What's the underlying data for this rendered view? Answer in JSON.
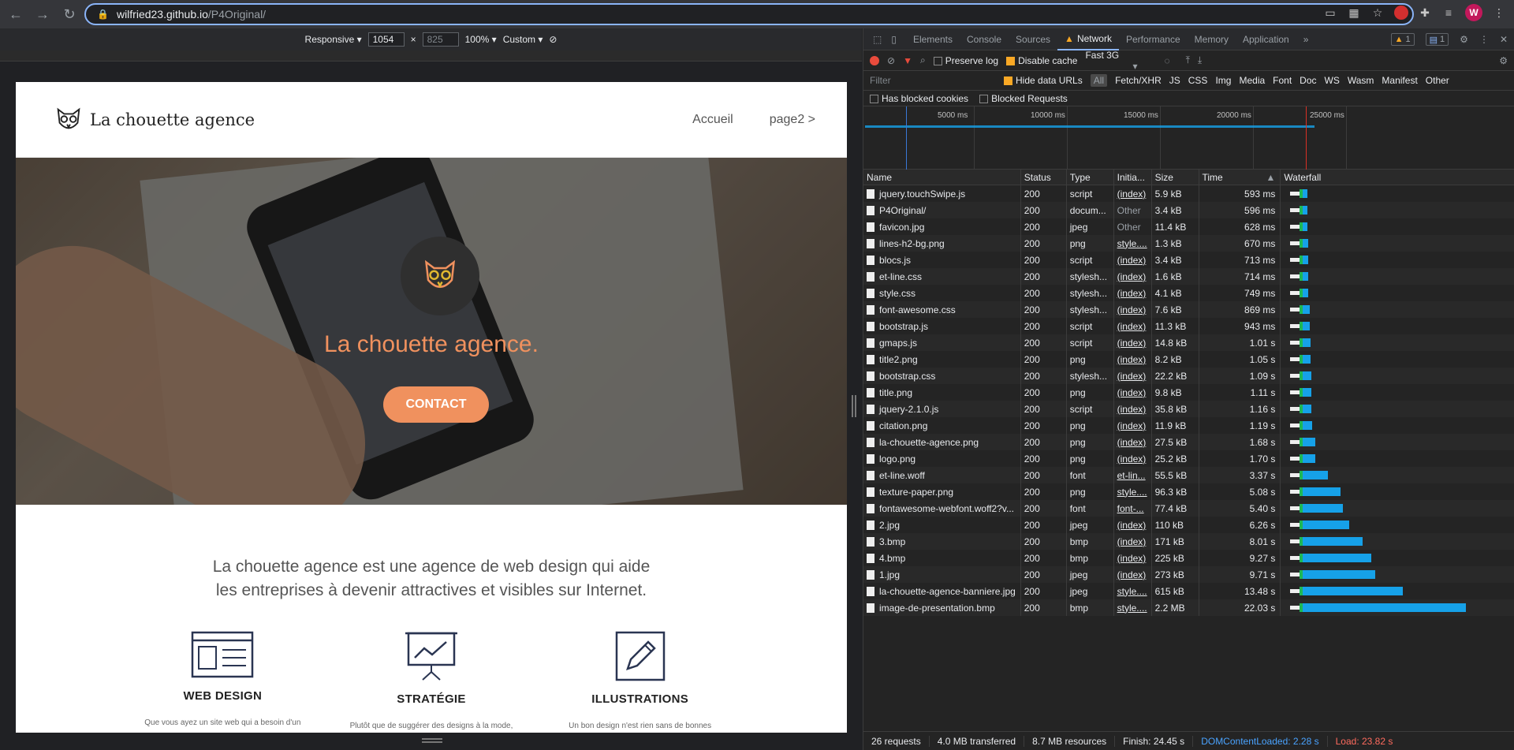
{
  "browser": {
    "url_host": "wilfried23.github.io",
    "url_path": "/P4Original/",
    "avatar_letter": "W"
  },
  "device_toolbar": {
    "mode": "Responsive",
    "width": "1054",
    "height": "825",
    "zoom": "100%",
    "throttle": "Custom"
  },
  "site": {
    "brand": "La chouette agence",
    "nav": [
      "Accueil",
      "page2 >"
    ],
    "hero_title": "La chouette agence.",
    "contact": "CONTACT",
    "intro_line1": "La chouette agence est une agence de web design qui aide",
    "intro_line2": "les entreprises à devenir attractives et visibles sur Internet.",
    "features": [
      {
        "title": "WEB DESIGN",
        "text": "Que vous ayez un site web qui a besoin d'un"
      },
      {
        "title": "STRATÉGIE",
        "text": "Plutôt que de suggérer des designs à la mode,"
      },
      {
        "title": "ILLUSTRATIONS",
        "text": "Un bon design n'est rien sans de bonnes"
      }
    ],
    "accent": "#f0915e"
  },
  "devtools": {
    "tabs": [
      "Elements",
      "Console",
      "Sources",
      "Network",
      "Performance",
      "Memory",
      "Application"
    ],
    "active_tab": "Network",
    "warn_count": "1",
    "msg_count": "1",
    "preserve_log": "Preserve log",
    "disable_cache": "Disable cache",
    "throttle": "Fast 3G",
    "filter_placeholder": "Filter",
    "hide_data_urls": "Hide data URLs",
    "all": "All",
    "types": [
      "Fetch/XHR",
      "JS",
      "CSS",
      "Img",
      "Media",
      "Font",
      "Doc",
      "WS",
      "Wasm",
      "Manifest",
      "Other"
    ],
    "has_blocked_cookies": "Has blocked cookies",
    "blocked_requests": "Blocked Requests",
    "overview_ticks": [
      "5000 ms",
      "10000 ms",
      "15000 ms",
      "20000 ms",
      "25000 ms"
    ],
    "columns": [
      "Name",
      "Status",
      "Type",
      "Initia...",
      "Size",
      "Time",
      "Waterfall"
    ],
    "requests": [
      {
        "name": "jquery.touchSwipe.js",
        "status": "200",
        "type": "script",
        "initiator": "(index)",
        "size": "5.9 kB",
        "time": "593 ms",
        "ms": 593
      },
      {
        "name": "P4Original/",
        "status": "200",
        "type": "docum...",
        "initiator": "Other",
        "size": "3.4 kB",
        "time": "596 ms",
        "ms": 596
      },
      {
        "name": "favicon.jpg",
        "status": "200",
        "type": "jpeg",
        "initiator": "Other",
        "size": "11.4 kB",
        "time": "628 ms",
        "ms": 628
      },
      {
        "name": "lines-h2-bg.png",
        "status": "200",
        "type": "png",
        "initiator": "style....",
        "size": "1.3 kB",
        "time": "670 ms",
        "ms": 670
      },
      {
        "name": "blocs.js",
        "status": "200",
        "type": "script",
        "initiator": "(index)",
        "size": "3.4 kB",
        "time": "713 ms",
        "ms": 713
      },
      {
        "name": "et-line.css",
        "status": "200",
        "type": "stylesh...",
        "initiator": "(index)",
        "size": "1.6 kB",
        "time": "714 ms",
        "ms": 714
      },
      {
        "name": "style.css",
        "status": "200",
        "type": "stylesh...",
        "initiator": "(index)",
        "size": "4.1 kB",
        "time": "749 ms",
        "ms": 749
      },
      {
        "name": "font-awesome.css",
        "status": "200",
        "type": "stylesh...",
        "initiator": "(index)",
        "size": "7.6 kB",
        "time": "869 ms",
        "ms": 869
      },
      {
        "name": "bootstrap.js",
        "status": "200",
        "type": "script",
        "initiator": "(index)",
        "size": "11.3 kB",
        "time": "943 ms",
        "ms": 943
      },
      {
        "name": "gmaps.js",
        "status": "200",
        "type": "script",
        "initiator": "(index)",
        "size": "14.8 kB",
        "time": "1.01 s",
        "ms": 1010
      },
      {
        "name": "title2.png",
        "status": "200",
        "type": "png",
        "initiator": "(index)",
        "size": "8.2 kB",
        "time": "1.05 s",
        "ms": 1050
      },
      {
        "name": "bootstrap.css",
        "status": "200",
        "type": "stylesh...",
        "initiator": "(index)",
        "size": "22.2 kB",
        "time": "1.09 s",
        "ms": 1090
      },
      {
        "name": "title.png",
        "status": "200",
        "type": "png",
        "initiator": "(index)",
        "size": "9.8 kB",
        "time": "1.11 s",
        "ms": 1110
      },
      {
        "name": "jquery-2.1.0.js",
        "status": "200",
        "type": "script",
        "initiator": "(index)",
        "size": "35.8 kB",
        "time": "1.16 s",
        "ms": 1160
      },
      {
        "name": "citation.png",
        "status": "200",
        "type": "png",
        "initiator": "(index)",
        "size": "11.9 kB",
        "time": "1.19 s",
        "ms": 1190
      },
      {
        "name": "la-chouette-agence.png",
        "status": "200",
        "type": "png",
        "initiator": "(index)",
        "size": "27.5 kB",
        "time": "1.68 s",
        "ms": 1680
      },
      {
        "name": "logo.png",
        "status": "200",
        "type": "png",
        "initiator": "(index)",
        "size": "25.2 kB",
        "time": "1.70 s",
        "ms": 1700
      },
      {
        "name": "et-line.woff",
        "status": "200",
        "type": "font",
        "initiator": "et-lin...",
        "size": "55.5 kB",
        "time": "3.37 s",
        "ms": 3370
      },
      {
        "name": "texture-paper.png",
        "status": "200",
        "type": "png",
        "initiator": "style....",
        "size": "96.3 kB",
        "time": "5.08 s",
        "ms": 5080
      },
      {
        "name": "fontawesome-webfont.woff2?v...",
        "status": "200",
        "type": "font",
        "initiator": "font-...",
        "size": "77.4 kB",
        "time": "5.40 s",
        "ms": 5400
      },
      {
        "name": "2.jpg",
        "status": "200",
        "type": "jpeg",
        "initiator": "(index)",
        "size": "110 kB",
        "time": "6.26 s",
        "ms": 6260
      },
      {
        "name": "3.bmp",
        "status": "200",
        "type": "bmp",
        "initiator": "(index)",
        "size": "171 kB",
        "time": "8.01 s",
        "ms": 8010
      },
      {
        "name": "4.bmp",
        "status": "200",
        "type": "bmp",
        "initiator": "(index)",
        "size": "225 kB",
        "time": "9.27 s",
        "ms": 9270
      },
      {
        "name": "1.jpg",
        "status": "200",
        "type": "jpeg",
        "initiator": "(index)",
        "size": "273 kB",
        "time": "9.71 s",
        "ms": 9710
      },
      {
        "name": "la-chouette-agence-banniere.jpg",
        "status": "200",
        "type": "jpeg",
        "initiator": "style....",
        "size": "615 kB",
        "time": "13.48 s",
        "ms": 13480
      },
      {
        "name": "image-de-presentation.bmp",
        "status": "200",
        "type": "bmp",
        "initiator": "style....",
        "size": "2.2 MB",
        "time": "22.03 s",
        "ms": 22030
      }
    ],
    "summary": {
      "requests": "26 requests",
      "transferred": "4.0 MB transferred",
      "resources": "8.7 MB resources",
      "finish": "Finish: 24.45 s",
      "dcl": "DOMContentLoaded: 2.28 s",
      "load": "Load: 23.82 s"
    },
    "colors": {
      "bar": "#16a1e8",
      "dcl": "#3a78d8",
      "load": "#d93025"
    }
  }
}
